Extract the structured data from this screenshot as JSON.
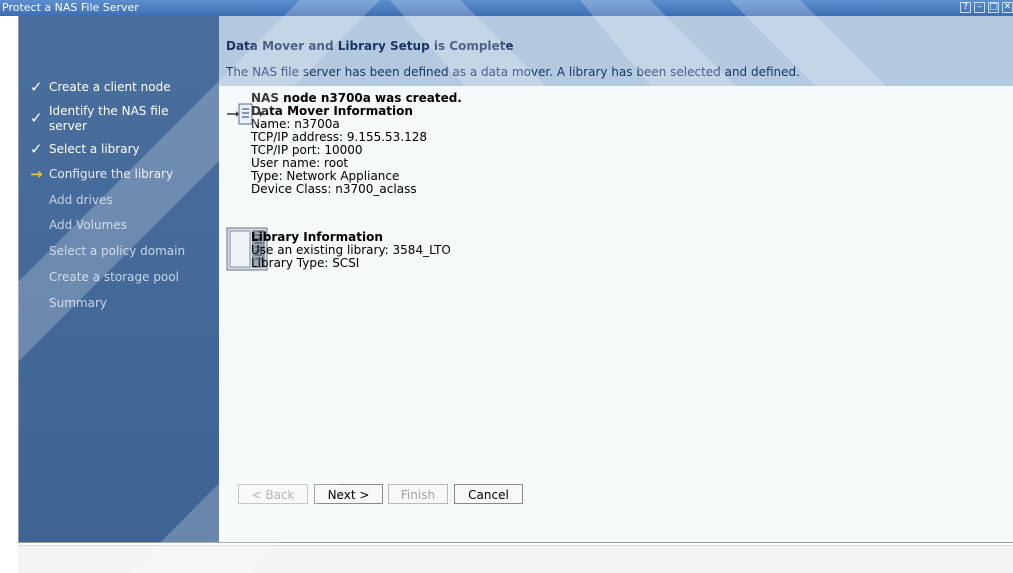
{
  "window": {
    "title": "Protect a NAS File Server",
    "controls": [
      "?",
      "–",
      "□"
    ]
  },
  "wizard": {
    "steps": [
      {
        "label": "Create a client node",
        "state": "done"
      },
      {
        "label": "Identify the NAS file server",
        "state": "done"
      },
      {
        "label": "Select a library",
        "state": "done"
      },
      {
        "label": "Configure the library",
        "state": "current"
      },
      {
        "label": "Add drives",
        "state": "pending"
      },
      {
        "label": "Add Volumes",
        "state": "pending"
      },
      {
        "label": "Select a policy domain",
        "state": "pending"
      },
      {
        "label": "Create a storage pool",
        "state": "pending"
      },
      {
        "label": "Summary",
        "state": "pending"
      }
    ]
  },
  "header": {
    "title": "Data Mover and Library Setup is Complete",
    "description": "The NAS file server has been defined as a data mover. A library has been selected and defined."
  },
  "data_mover": {
    "created_message": "NAS node n3700a was created.",
    "section_title": "Data Mover Information",
    "lines": [
      "Name: n3700a",
      "TCP/IP address: 9.155.53.128",
      "TCP/IP port: 10000",
      "User name: root",
      "Type: Network Appliance",
      "Device Class: n3700_aclass"
    ]
  },
  "library": {
    "section_title": "Library Information",
    "lines": [
      "Use an existing library: 3584_LTO",
      "Library Type: SCSI"
    ]
  },
  "buttons": {
    "back": "< Back",
    "next": "Next >",
    "finish": "Finish",
    "cancel": "Cancel"
  },
  "icons": {
    "data_mover": "data-mover-icon",
    "library": "library-icon"
  },
  "colors": {
    "title_bar": "#3d6eb4",
    "nav_background": "#4a6f9e",
    "header_band": "#b4c9e0",
    "content_background": "#f5f9f9",
    "current_step_arrow": "#f0c030"
  }
}
